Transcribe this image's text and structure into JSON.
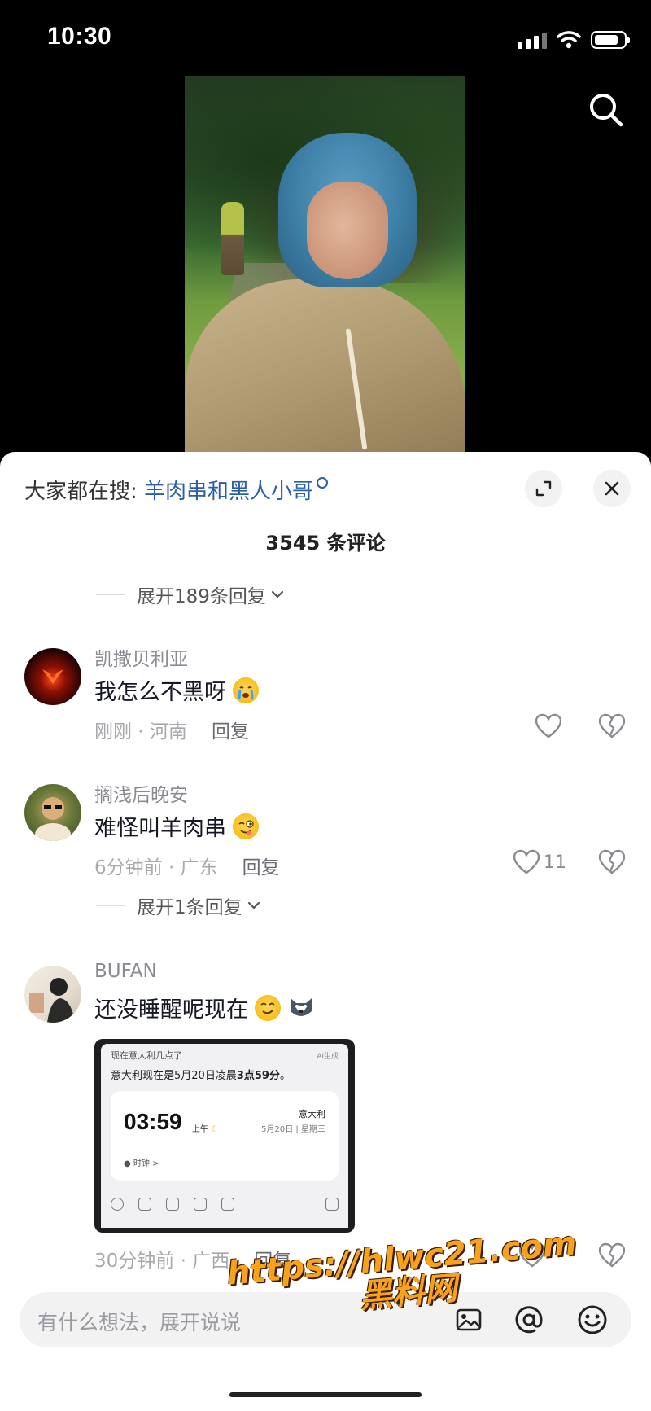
{
  "status_bar": {
    "time": "10:30"
  },
  "trending": {
    "prefix": "大家都在搜:",
    "term": "羊肉串和黑人小哥"
  },
  "comment_count": "3545 条评论",
  "expand_replies_top": "展开189条回复",
  "comments": [
    {
      "username": "凯撒贝利亚",
      "text": "我怎么不黑呀",
      "time_location": "刚刚 · 河南",
      "reply": "回复",
      "likes": ""
    },
    {
      "username": "搁浅后晚安",
      "text": "难怪叫羊肉串",
      "time_location": "6分钟前 · 广东",
      "reply": "回复",
      "likes": "11",
      "expand_replies": "展开1条回复"
    },
    {
      "username": "BUFAN",
      "text": "还没睡醒呢现在",
      "time_location": "30分钟前 · 广西",
      "reply": "回复",
      "screenshot": {
        "question": "现在意大利几点了",
        "ai_tag": "AI生成",
        "answer_prefix": "意大利现在是5月20日凌晨",
        "answer_bold": "3点59分",
        "answer_suffix": "。",
        "time": "03:59",
        "ampm": "上午",
        "city": "意大利",
        "date": "5月20日 | 星期三",
        "clock_link": "时钟 >"
      }
    }
  ],
  "input": {
    "placeholder": "有什么想法，展开说说"
  },
  "watermark": {
    "line1": "https://hlwc21.com",
    "line2": "黑料网"
  },
  "icons": [
    "search-icon",
    "expand-icon",
    "close-icon",
    "heart-icon",
    "broken-heart-icon",
    "image-icon",
    "at-icon",
    "emoji-icon"
  ]
}
